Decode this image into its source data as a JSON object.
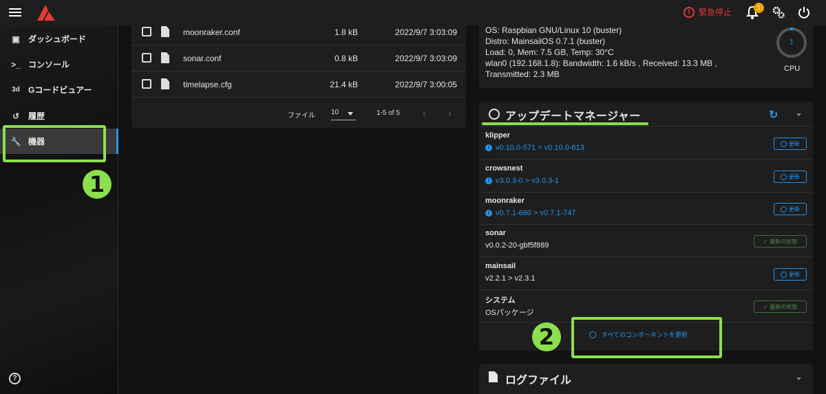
{
  "topbar": {
    "estop_label": "緊急停止",
    "notification_count": "1",
    "accent_color": "#e53935",
    "icons": [
      "menu-icon",
      "mainsail-logo",
      "alert-circle-icon",
      "bell-icon",
      "gears-icon",
      "power-icon"
    ]
  },
  "sidebar": {
    "items": [
      {
        "icon": "dashboard-icon",
        "label": "ダッシュボード"
      },
      {
        "icon": "console-icon",
        "label": "コンソール"
      },
      {
        "icon": "3d",
        "label": "Gコードビュアー"
      },
      {
        "icon": "history-icon",
        "label": "履歴"
      },
      {
        "icon": "wrench-icon",
        "label": "機器"
      }
    ],
    "help_icon": "?"
  },
  "annotations": {
    "marker1": "1",
    "marker2": "2",
    "highlight_color": "#8be04e"
  },
  "files": {
    "rows": [
      {
        "name": "moonraker.conf",
        "size": "1.8 kB",
        "date": "2022/9/7 3:03:09"
      },
      {
        "name": "sonar.conf",
        "size": "0.8 kB",
        "date": "2022/9/7 3:03:09"
      },
      {
        "name": "timelapse.cfg",
        "size": "21.4 kB",
        "date": "2022/9/7 3:00:05"
      }
    ],
    "pager": {
      "rows_per_page_label": "ファイル",
      "rows_per_page": "10",
      "range": "1-5 of 5"
    }
  },
  "sysinfo": {
    "os": "OS: Raspbian GNU/Linux 10 (buster)",
    "distro": "Distro: MainsailOS 0.7.1 (buster)",
    "load": "Load: 0, Mem: 7.5 GB, Temp: 30°C",
    "wlan": "wlan0 (192.168.1.8): Bandwidth: 1.6 kB/s , Received: 13.3 MB ,",
    "transmitted": "Transmitted: 2.3 MB",
    "cpu_value": "1",
    "cpu_label": "CPU"
  },
  "updater": {
    "title": "アップデートマネージャー",
    "components": [
      {
        "name": "klipper",
        "version": "v0.10.0-571 > v0.10.0-613",
        "has_update": true,
        "button": "更新"
      },
      {
        "name": "crowsnest",
        "version": "v3.0.3-0 > v3.0.3-1",
        "has_update": true,
        "button": "更新"
      },
      {
        "name": "moonraker",
        "version": "v0.7.1-660 > v0.7.1-747",
        "has_update": true,
        "button": "更新"
      },
      {
        "name": "sonar",
        "version": "v0.0.2-20-gbf5f889",
        "has_update": false,
        "button": "最新の状態"
      },
      {
        "name": "mainsail",
        "version": "v2.2.1 > v2.3.1",
        "has_update": true,
        "button": "更新"
      },
      {
        "name": "システム",
        "version": "OSパッケージ",
        "has_update": false,
        "button": "最新の状態"
      }
    ],
    "update_all_label": "すべてのコンポーネントを更新"
  },
  "logs": {
    "title": "ログファイル"
  }
}
